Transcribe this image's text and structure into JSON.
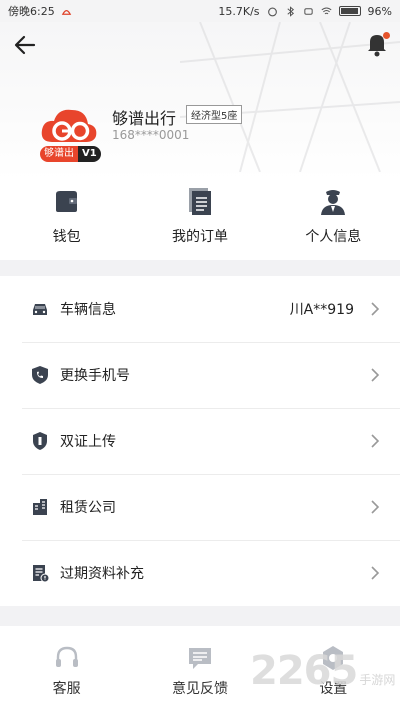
{
  "status_bar": {
    "time": "傍晚6:25",
    "network_speed": "15.7K/s",
    "battery": "96%"
  },
  "header": {
    "driver_name": "够谱出行",
    "car_tag": "经济型5座",
    "phone": "168****0001",
    "avatar_logo": "GO",
    "avatar_badge_text": "够谱出",
    "avatar_badge_level": "V1",
    "accent_color": "#e8452c"
  },
  "quick_actions": [
    {
      "label": "钱包",
      "icon": "wallet-icon"
    },
    {
      "label": "我的订单",
      "icon": "orders-icon"
    },
    {
      "label": "个人信息",
      "icon": "profile-icon"
    }
  ],
  "menu": [
    {
      "label": "车辆信息",
      "value": "川A**919",
      "icon": "car-icon"
    },
    {
      "label": "更换手机号",
      "value": "",
      "icon": "phone-shield-icon"
    },
    {
      "label": "双证上传",
      "value": "",
      "icon": "badge-shield-icon"
    },
    {
      "label": "租赁公司",
      "value": "",
      "icon": "building-icon"
    },
    {
      "label": "过期资料补充",
      "value": "",
      "icon": "document-alert-icon"
    }
  ],
  "tabbar": [
    {
      "label": "客服",
      "icon": "headset-icon"
    },
    {
      "label": "意见反馈",
      "icon": "feedback-icon"
    },
    {
      "label": "设置",
      "icon": "settings-icon"
    }
  ],
  "watermark": {
    "big": "2265",
    "small": "手游网"
  }
}
